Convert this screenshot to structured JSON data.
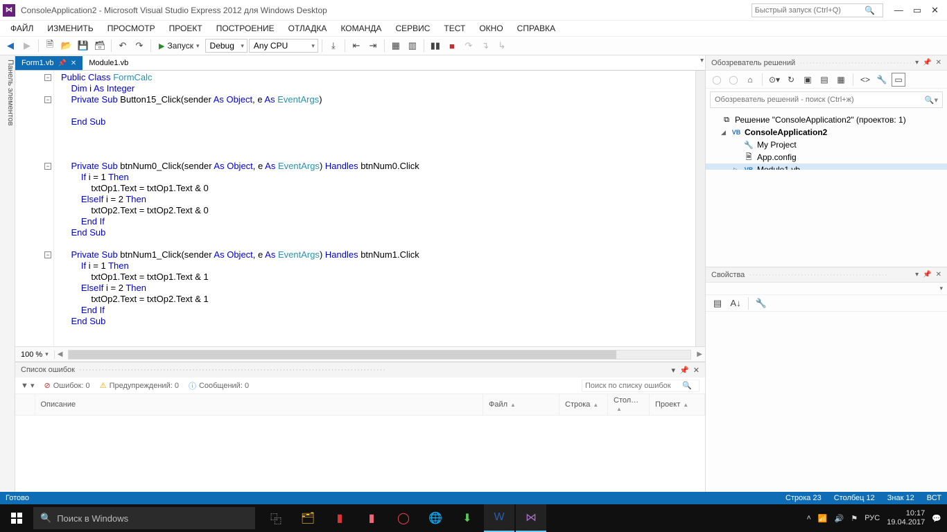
{
  "title": "ConsoleApplication2 - Microsoft Visual Studio Express 2012 для Windows Desktop",
  "quicklaunch_placeholder": "Быстрый запуск (Ctrl+Q)",
  "menu": [
    "ФАЙЛ",
    "ИЗМЕНИТЬ",
    "ПРОСМОТР",
    "ПРОЕКТ",
    "ПОСТРОЕНИЕ",
    "ОТЛАДКА",
    "КОМАНДА",
    "СЕРВИС",
    "ТЕСТ",
    "ОКНО",
    "СПРАВКА"
  ],
  "toolbar": {
    "run_label": "Запуск",
    "config": "Debug",
    "platform": "Any CPU"
  },
  "left_panel_label": "Панель элементов",
  "tabs": [
    {
      "label": "Form1.vb",
      "active": true
    },
    {
      "label": "Module1.vb",
      "active": false
    }
  ],
  "zoom": "100 %",
  "errorlist": {
    "title": "Список ошибок",
    "errors": "Ошибок: 0",
    "warnings": "Предупреждений: 0",
    "messages": "Сообщений: 0",
    "search_placeholder": "Поиск по списку ошибок",
    "cols": [
      "",
      "Описание",
      "Файл",
      "Строка",
      "Стол…",
      "Проект"
    ]
  },
  "solution_explorer": {
    "title": "Обозреватель решений",
    "search_placeholder": "Обозреватель решений - поиск (Ctrl+ж)",
    "root": "Решение \"ConsoleApplication2\" (проектов: 1)",
    "project": "ConsoleApplication2",
    "items": [
      "My Project",
      "App.config",
      "Module1.vb"
    ]
  },
  "properties": {
    "title": "Свойства"
  },
  "status": {
    "ready": "Готово",
    "line": "Строка 23",
    "col": "Столбец 12",
    "char": "Знак 12",
    "ins": "ВСТ"
  },
  "taskbar": {
    "search_placeholder": "Поиск в Windows",
    "lang": "РУС",
    "time": "10:17",
    "date": "19.04.2017"
  },
  "code_lines": [
    [
      [
        "kw",
        "Public"
      ],
      [
        "p",
        " "
      ],
      [
        "kw",
        "Class"
      ],
      [
        "p",
        " "
      ],
      [
        "typ",
        "FormCalc"
      ]
    ],
    [
      [
        "p",
        "    "
      ],
      [
        "kw",
        "Dim"
      ],
      [
        "p",
        " i "
      ],
      [
        "kw",
        "As"
      ],
      [
        "p",
        " "
      ],
      [
        "kw",
        "Integer"
      ]
    ],
    [
      [
        "p",
        "    "
      ],
      [
        "kw",
        "Private"
      ],
      [
        "p",
        " "
      ],
      [
        "kw",
        "Sub"
      ],
      [
        "p",
        " Button15_Click(sender "
      ],
      [
        "kw",
        "As"
      ],
      [
        "p",
        " "
      ],
      [
        "kw",
        "Object"
      ],
      [
        "p",
        ", e "
      ],
      [
        "kw",
        "As"
      ],
      [
        "p",
        " "
      ],
      [
        "typ",
        "EventArgs"
      ],
      [
        "p",
        ")"
      ]
    ],
    [
      [
        "p",
        ""
      ]
    ],
    [
      [
        "p",
        "    "
      ],
      [
        "kw",
        "End"
      ],
      [
        "p",
        " "
      ],
      [
        "kw",
        "Sub"
      ]
    ],
    [
      [
        "p",
        ""
      ]
    ],
    [
      [
        "p",
        ""
      ]
    ],
    [
      [
        "p",
        ""
      ]
    ],
    [
      [
        "p",
        "    "
      ],
      [
        "kw",
        "Private"
      ],
      [
        "p",
        " "
      ],
      [
        "kw",
        "Sub"
      ],
      [
        "p",
        " btnNum0_Click(sender "
      ],
      [
        "kw",
        "As"
      ],
      [
        "p",
        " "
      ],
      [
        "kw",
        "Object"
      ],
      [
        "p",
        ", e "
      ],
      [
        "kw",
        "As"
      ],
      [
        "p",
        " "
      ],
      [
        "typ",
        "EventArgs"
      ],
      [
        "p",
        ") "
      ],
      [
        "kw",
        "Handles"
      ],
      [
        "p",
        " btnNum0.Click"
      ]
    ],
    [
      [
        "p",
        "        "
      ],
      [
        "kw",
        "If"
      ],
      [
        "p",
        " i = 1 "
      ],
      [
        "kw",
        "Then"
      ]
    ],
    [
      [
        "p",
        "            txtOp1.Text = txtOp1.Text & 0"
      ]
    ],
    [
      [
        "p",
        "        "
      ],
      [
        "kw",
        "ElseIf"
      ],
      [
        "p",
        " i = 2 "
      ],
      [
        "kw",
        "Then"
      ]
    ],
    [
      [
        "p",
        "            txtOp2.Text = txtOp2.Text & 0"
      ]
    ],
    [
      [
        "p",
        "        "
      ],
      [
        "kw",
        "End"
      ],
      [
        "p",
        " "
      ],
      [
        "kw",
        "If"
      ]
    ],
    [
      [
        "p",
        "    "
      ],
      [
        "kw",
        "End"
      ],
      [
        "p",
        " "
      ],
      [
        "kw",
        "Sub"
      ]
    ],
    [
      [
        "p",
        ""
      ]
    ],
    [
      [
        "p",
        "    "
      ],
      [
        "kw",
        "Private"
      ],
      [
        "p",
        " "
      ],
      [
        "kw",
        "Sub"
      ],
      [
        "p",
        " btnNum1_Click(sender "
      ],
      [
        "kw",
        "As"
      ],
      [
        "p",
        " "
      ],
      [
        "kw",
        "Object"
      ],
      [
        "p",
        ", e "
      ],
      [
        "kw",
        "As"
      ],
      [
        "p",
        " "
      ],
      [
        "typ",
        "EventArgs"
      ],
      [
        "p",
        ") "
      ],
      [
        "kw",
        "Handles"
      ],
      [
        "p",
        " btnNum1.Click"
      ]
    ],
    [
      [
        "p",
        "        "
      ],
      [
        "kw",
        "If"
      ],
      [
        "p",
        " i = 1 "
      ],
      [
        "kw",
        "Then"
      ]
    ],
    [
      [
        "p",
        "            txtOp1.Text = txtOp1.Text & 1"
      ]
    ],
    [
      [
        "p",
        "        "
      ],
      [
        "kw",
        "ElseIf"
      ],
      [
        "p",
        " i = 2 "
      ],
      [
        "kw",
        "Then"
      ]
    ],
    [
      [
        "p",
        "            txtOp2.Text = txtOp2.Text & 1"
      ]
    ],
    [
      [
        "p",
        "        "
      ],
      [
        "kw",
        "End"
      ],
      [
        "p",
        " "
      ],
      [
        "kw",
        "If"
      ]
    ],
    [
      [
        "p",
        "    "
      ],
      [
        "kw",
        "End"
      ],
      [
        "p",
        " "
      ],
      [
        "kw",
        "Sub"
      ]
    ]
  ],
  "fold_markers": [
    0,
    2,
    8,
    16
  ]
}
